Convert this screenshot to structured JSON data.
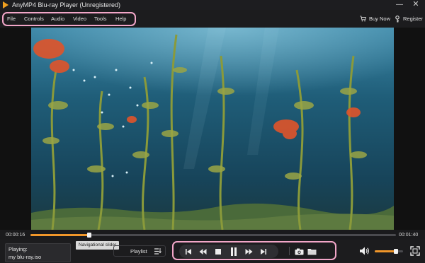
{
  "window": {
    "title": "AnyMP4 Blu-ray Player (Unregistered)",
    "minimize_glyph": "—",
    "close_glyph": "✕"
  },
  "menu": {
    "items": [
      "File",
      "Controls",
      "Audio",
      "Video",
      "Tools",
      "Help"
    ]
  },
  "header_actions": {
    "buy_now": "Buy Now",
    "register": "Register"
  },
  "playback": {
    "current_time": "00:00:16",
    "total_time": "00:01:40",
    "progress_fraction": 0.16,
    "tooltip": "Navigational slider"
  },
  "now_playing": {
    "label": "Playing:",
    "file": "my blu-ray.iso"
  },
  "playlist": {
    "label": "Playlist"
  },
  "controls": {
    "icons": [
      "skip-previous-icon",
      "rewind-icon",
      "stop-icon",
      "pause-icon",
      "fast-forward-icon",
      "skip-next-icon",
      "camera-snapshot-icon",
      "folder-icon"
    ]
  },
  "volume": {
    "level_fraction": 0.75
  },
  "colors": {
    "accent": "#f0962a",
    "highlight_outline": "#f2a6c8",
    "background": "#1c1c1e"
  }
}
